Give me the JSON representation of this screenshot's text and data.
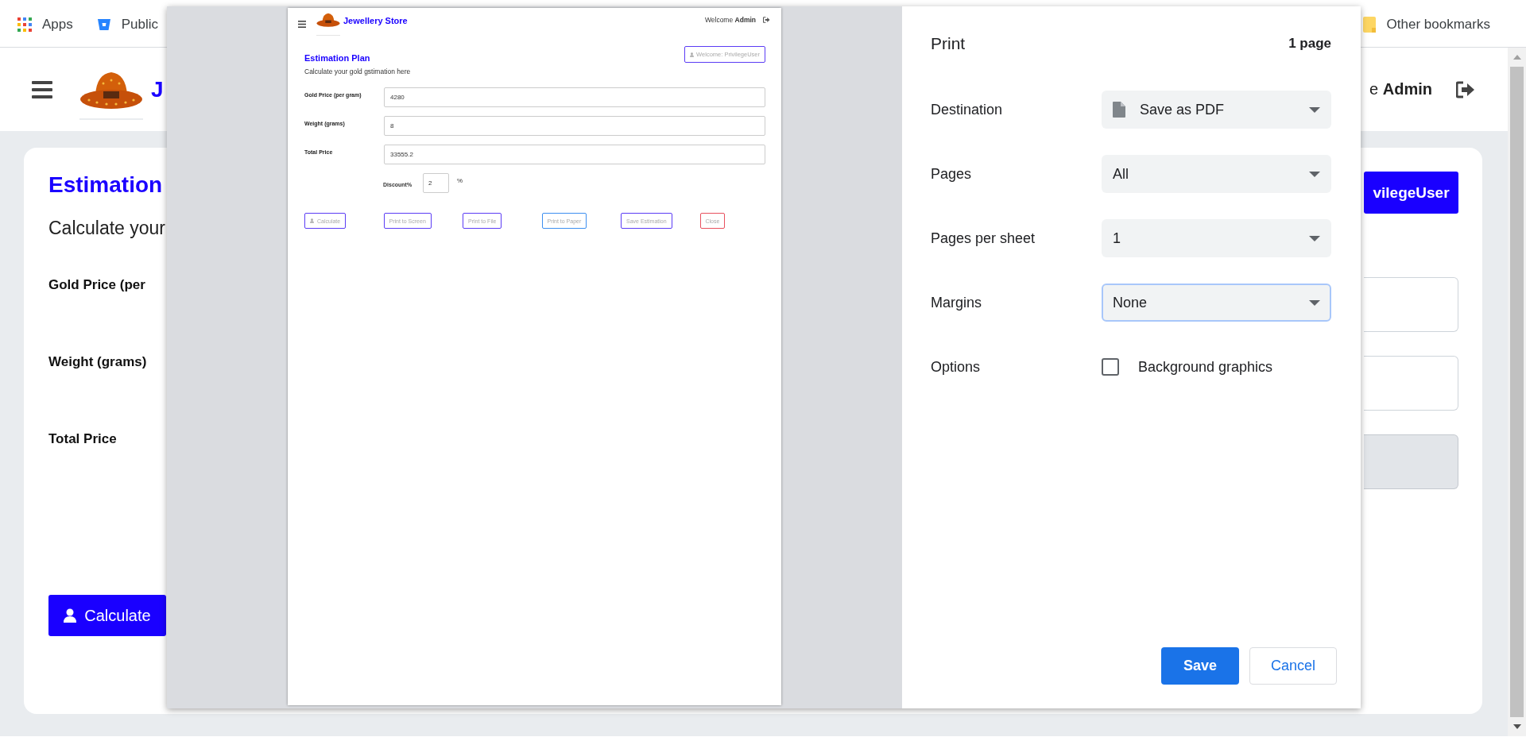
{
  "bookmarks_bar": {
    "items": [
      {
        "label": "Apps",
        "kind": "apps"
      },
      {
        "label": "Public",
        "kind": "bucket"
      }
    ],
    "other": "Other bookmarks"
  },
  "app_header": {
    "brand": "J",
    "user": "e **Admin**"
  },
  "page": {
    "title": "Estimation",
    "subtitle": "Calculate your",
    "user_button": "vilegeUser",
    "fields": [
      {
        "label": "Gold Price (per",
        "readonly": false
      },
      {
        "label": "Weight (grams)",
        "readonly": false
      },
      {
        "label": "Total Price",
        "readonly": true
      }
    ],
    "calculate_button": "Calculate"
  },
  "print_dialog": {
    "preview": {
      "brand": "Jewellery Store",
      "welcome": "Welcome **Admin**",
      "title": "Estimation Plan",
      "subtitle": "Calculate your gold gstimation here",
      "user_button": "Welcome: PrivilegeUser",
      "fields": [
        {
          "label": "Gold Price (per gram)",
          "value": "4280"
        },
        {
          "label": "Weight (grams)",
          "value": "8"
        },
        {
          "label": "Total Price",
          "value": "33555.2"
        }
      ],
      "discount": {
        "label": "Discount%",
        "value": "2",
        "unit": "%"
      },
      "buttons": [
        {
          "label": "Calculate",
          "kind": "icon",
          "color": "#5b3cf5"
        },
        {
          "label": "Print to Screen",
          "kind": "plain",
          "color": "#5b3cf5"
        },
        {
          "label": "Print to File",
          "kind": "plain",
          "color": "#5b3cf5"
        },
        {
          "label": "Print to Paper",
          "kind": "plain",
          "color": "#3d8ff0"
        },
        {
          "label": "Save Estimation",
          "kind": "plain",
          "color": "#5b3cf5"
        },
        {
          "label": "Close",
          "kind": "plain",
          "color": "#e8505e"
        }
      ]
    },
    "title": "Print",
    "page_count": "1 page",
    "settings": [
      {
        "label": "Destination",
        "kind": "destination",
        "value": "Save as PDF",
        "focused": false
      },
      {
        "label": "Pages",
        "kind": "select",
        "value": "All",
        "focused": false
      },
      {
        "label": "Pages per sheet",
        "kind": "select",
        "value": "1",
        "focused": false
      },
      {
        "label": "Margins",
        "kind": "select",
        "value": "None",
        "focused": true
      },
      {
        "label": "Options",
        "kind": "checkbox",
        "value": "Background graphics",
        "checked": false
      }
    ],
    "buttons": [
      {
        "label": "Save",
        "kind": "primary"
      },
      {
        "label": "Cancel",
        "kind": "secondary"
      }
    ]
  }
}
